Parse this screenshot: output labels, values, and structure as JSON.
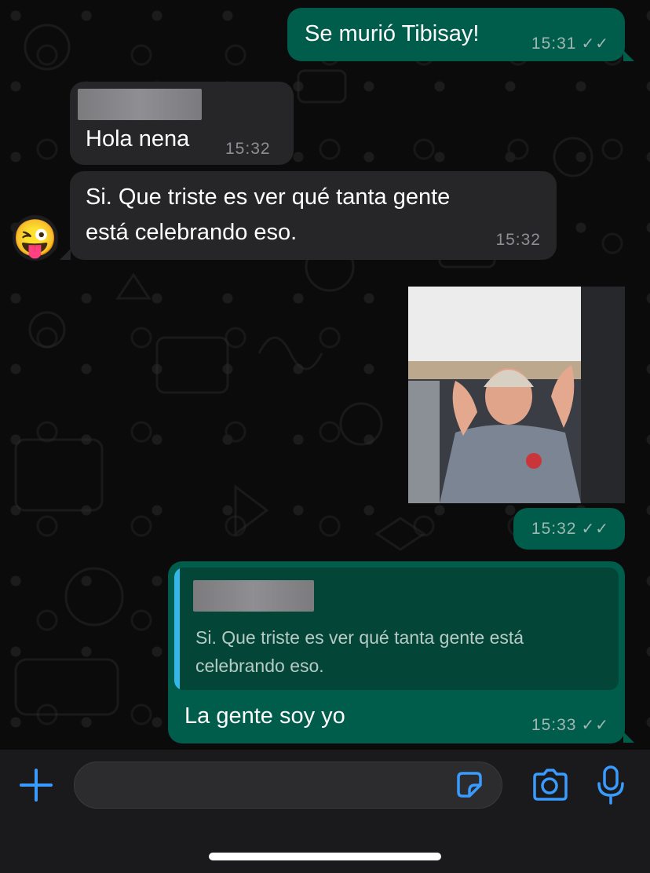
{
  "messages": [
    {
      "id": "m1",
      "dir": "out",
      "text": "Se murió Tibisay!",
      "time": "15:31",
      "ticks": "✓✓"
    },
    {
      "id": "m2",
      "dir": "in",
      "text": "Hola nena",
      "time": "15:32"
    },
    {
      "id": "m3",
      "dir": "in",
      "text": "Si. Que triste es ver qué tanta gente está celebrando eso.",
      "time": "15:32",
      "line1": "Si. Que triste es ver qué tanta gente",
      "line2": "está celebrando eso."
    },
    {
      "id": "m4",
      "dir": "out",
      "type": "image",
      "time": "15:32",
      "ticks": "✓✓"
    },
    {
      "id": "m5",
      "dir": "out",
      "text": "La gente soy yo",
      "time": "15:33",
      "ticks": "✓✓",
      "quote": {
        "line1": "Si. Que triste es ver qué tanta gente está",
        "line2": "celebrando eso."
      }
    }
  ],
  "avatar": {
    "emoji": "😜"
  },
  "composer": {
    "placeholder": ""
  },
  "icons": {
    "plus": "plus-icon",
    "sticker": "sticker-icon",
    "camera": "camera-icon",
    "mic": "microphone-icon"
  },
  "colors": {
    "outgoing": "#005c4b",
    "incoming": "#262628",
    "accent": "#3a9bff",
    "quote_bar": "#35b6e8"
  }
}
